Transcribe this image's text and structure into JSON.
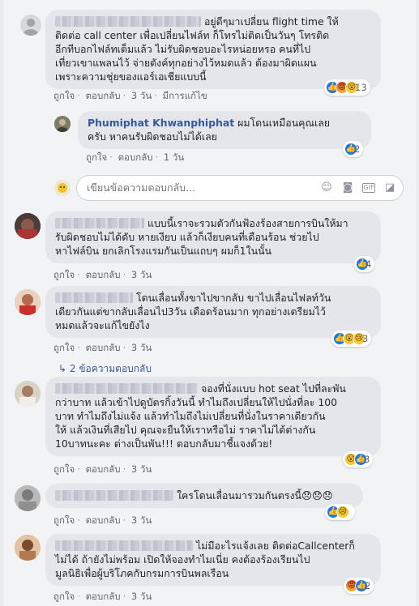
{
  "comments": [
    {
      "lines": [
        "อยู่ดีๆมาเปลี่ยน flight time ให้",
        "ติดต่อ call center เพื่อเปลี่ยนไฟล์ท ก็โทรไม่ติดเป็นวันๆ โทรติด",
        "อีกทีบอกไฟล์ทเต็มแล้ว ไม่รับผิดชอบอะไรหน่อยหรอ คนที่ไป",
        "เที่ยวเขาแพลนไว้ จ่ายตังค์ทุกอย่างไว้หมดแล้ว ต้องมาผิดแผน",
        "เพราะความชุ่ยของแอร์เอเชียแบบนี้"
      ],
      "actions": {
        "like": "ถูกใจ",
        "reply": "ตอบกลับ",
        "time": "3 วัน",
        "edited": "มีการแก้ไข"
      },
      "reaction_count": "13"
    },
    {
      "author": "Phumiphat Khwanphiphat",
      "lines": [
        "ผมโดนเหมือนคุณเลย",
        "ครับ หาคนรับผิดชอบไม่ได้เลย"
      ],
      "actions": {
        "like": "ถูกใจ",
        "reply": "ตอบกลับ",
        "time": "1 วัน"
      },
      "reaction_count": "2"
    },
    {
      "lines": [
        "แบบนี้เราจะรวมตัวกันฟ้องร้องสายการบินให้มา",
        "รับผิดชอบไม่ได้ดับ หายเงียบ แล้วก็เงียบคนที่เดือนร้อน ช่วยไป",
        "หาไฟล์บิน ยกเลิกโรงแรมกันเป็นแถบๆ ผมก็1ในนั้น"
      ],
      "actions": {
        "like": "ถูกใจ",
        "reply": "ตอบกลับ",
        "time": "3 วัน"
      },
      "reaction_count": "4"
    },
    {
      "lines": [
        "โดนเลื่อนทั้งขาไปขากลับ ขาไปเลื่อนไฟลท์วัน",
        "เดียวกันแต่ขากลับเลื่อนไป3วัน เดือดร้อนมาก ทุกอย่างเตรียมไว้",
        "หมดแล้วจะแก้ไขยังไง"
      ],
      "actions": {
        "like": "ถูกใจ",
        "reply": "ตอบกลับ",
        "time": "3 วัน"
      },
      "reaction_count": "3"
    },
    {
      "lines": [
        "จองที่นั่งแบบ hot seat ไปที่ละพัน",
        "กว่าบาท แล้วเข้าไปดูบัตรกิ้งวันนี้ ทำไมถึงเปลี่ยนให้ไปนั่งที่ละ 100",
        "บาท ทำไมถึงไม่แจ้ง แล้วทำไมถึงไม่เปลี่ยนที่นั่งในราคาเดียวกัน",
        "ให้ แล้วเงินที่เสียไป คุณจะยืนให้เราหรือไม่ ราคาไม่ได้ต่างกัน",
        "10บาทนะคะ ต่างเป็นพัน!!! ตอบกลับมาชี้แจงด้วย!"
      ],
      "actions": {
        "like": "ถูกใจ",
        "reply": "ตอบกลับ",
        "time": "3 วัน"
      },
      "reaction_count": "3"
    },
    {
      "lines": [
        "ใครโดนเลื่อนมารวมกันตรงนี้😞😞😞"
      ],
      "actions": {
        "like": "ถูกใจ",
        "reply": "ตอบกลับ",
        "time": "3 วัน"
      }
    },
    {
      "lines": [
        "ไม่มีอะไรแจ้งเลย ติดต่อCallcenterก็",
        "ไม่ได้ ถ้ายังไม่พร้อม เปิดให้จองทำไมเนี่ย คงต้องร้องเรียนไป",
        "มูลนิธิเพื่อผู้บริโภคกับกรมการบินพลเรือน"
      ],
      "actions": {
        "like": "ถูกใจ",
        "reply": "ตอบกลับ",
        "time": "3 วัน"
      },
      "reaction_count": "2"
    }
  ],
  "reply_box": {
    "placeholder": "เขียนข้อความตอบกลับ..."
  },
  "more_replies": "2 ข้อความตอบกลับ",
  "colors": {
    "link": "#385898",
    "bubble": "#e4e6eb",
    "like_blue": "#1877f2"
  }
}
